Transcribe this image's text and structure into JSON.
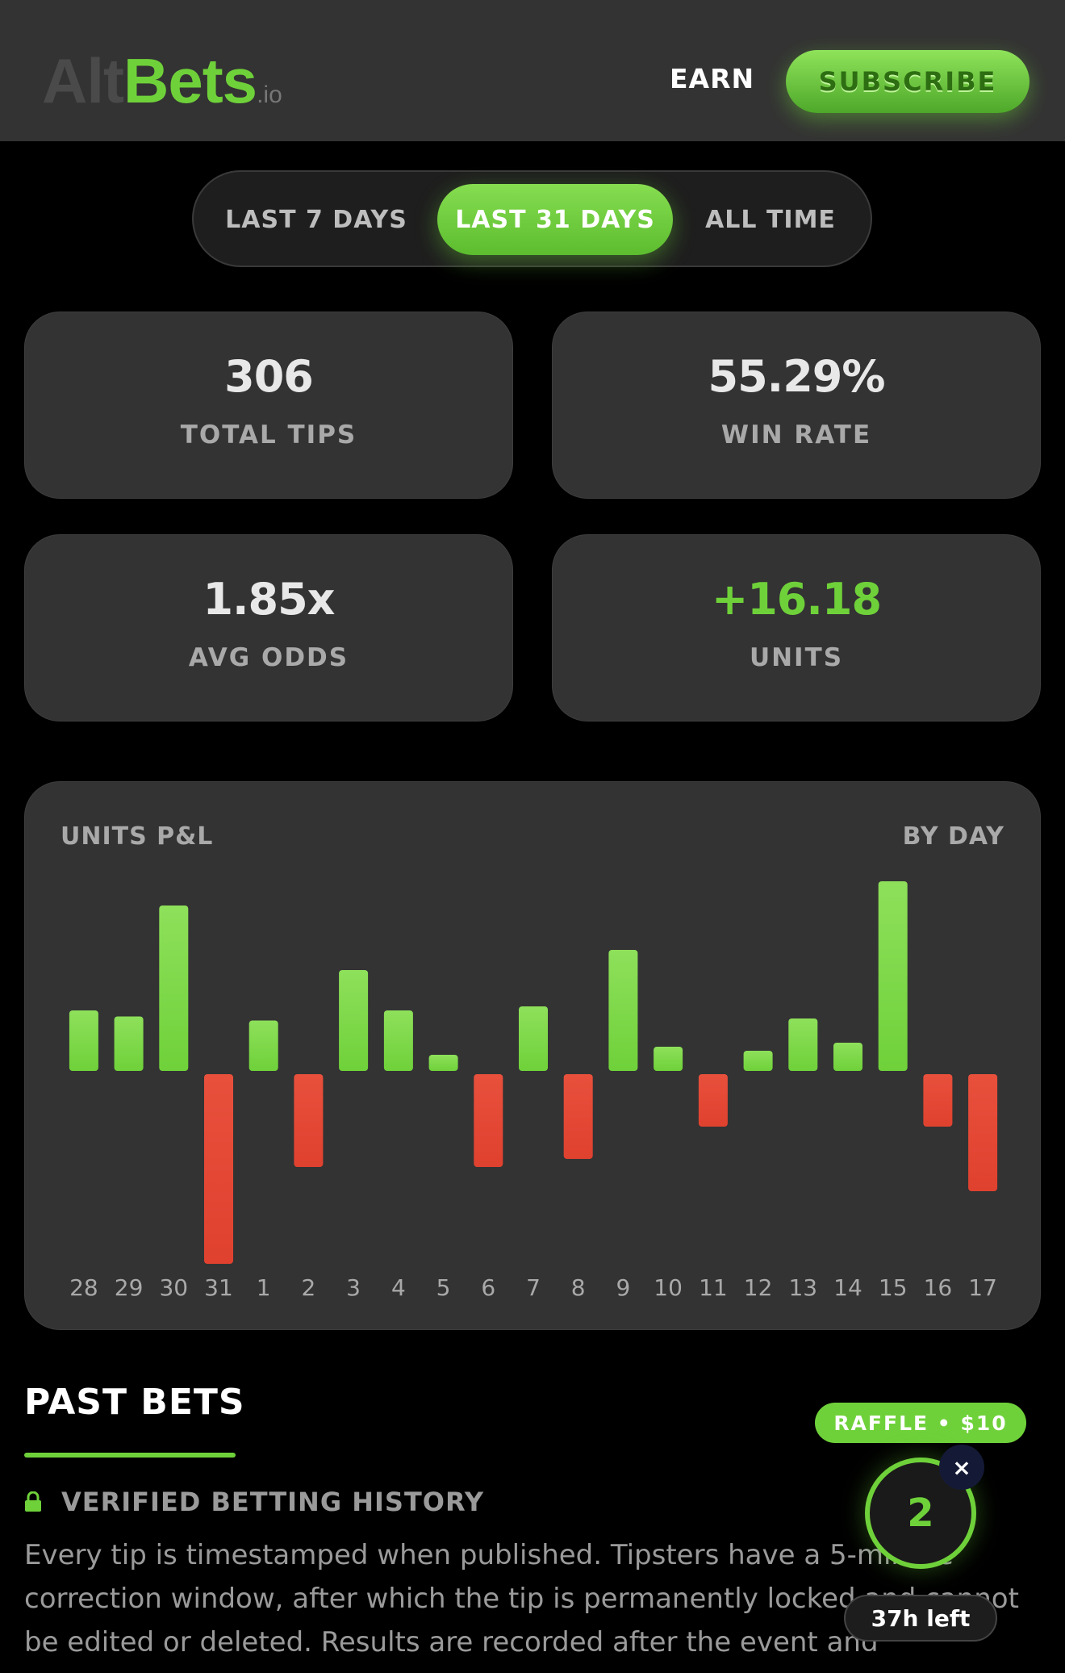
{
  "header": {
    "logo_alt": "Alt",
    "logo_bets": "Bets",
    "logo_io": ".io",
    "earn_label": "EARN",
    "subscribe_label": "SUBSCRIBE"
  },
  "period_tabs": [
    {
      "label": "LAST 7 DAYS",
      "active": false
    },
    {
      "label": "LAST 31 DAYS",
      "active": true
    },
    {
      "label": "ALL TIME",
      "active": false
    }
  ],
  "stats": {
    "total_tips": {
      "value": "306",
      "label": "TOTAL TIPS"
    },
    "win_rate": {
      "value": "55.29%",
      "label": "WIN RATE"
    },
    "avg_odds": {
      "value": "1.85x",
      "label": "AVG ODDS"
    },
    "units": {
      "value": "+16.18",
      "label": "UNITS"
    }
  },
  "chart_title": "UNITS P&L",
  "chart_mode": "BY DAY",
  "chart_data": {
    "type": "bar",
    "title": "UNITS P&L",
    "categories": [
      "28",
      "29",
      "30",
      "31",
      "1",
      "2",
      "3",
      "4",
      "5",
      "6",
      "7",
      "8",
      "9",
      "10",
      "11",
      "12",
      "13",
      "14",
      "15",
      "16",
      "17"
    ],
    "values": [
      1.5,
      1.35,
      4.1,
      -4.7,
      1.25,
      -2.3,
      2.5,
      1.5,
      0.4,
      -2.3,
      1.6,
      -2.1,
      3.0,
      0.6,
      -1.3,
      0.5,
      1.3,
      0.7,
      4.7,
      -1.3,
      -2.9
    ],
    "positive_color": "#6fd13a",
    "negative_color": "#e0412f",
    "grid": false
  },
  "past_bets": {
    "title": "PAST BETS",
    "verified_label": "VERIFIED BETTING HISTORY",
    "description": "Every tip is timestamped when published. Tipsters have a 5-minute correction window, after which the tip is permanently locked and cannot be edited or deleted. Results are recorded after the event and"
  },
  "raffle": {
    "label": "RAFFLE • $10",
    "count": "2",
    "close_glyph": "×",
    "time_left": "37h left"
  },
  "colors": {
    "accent": "#6fd13a",
    "negative": "#e0412f",
    "card_bg": "#333333",
    "page_bg": "#000000"
  }
}
